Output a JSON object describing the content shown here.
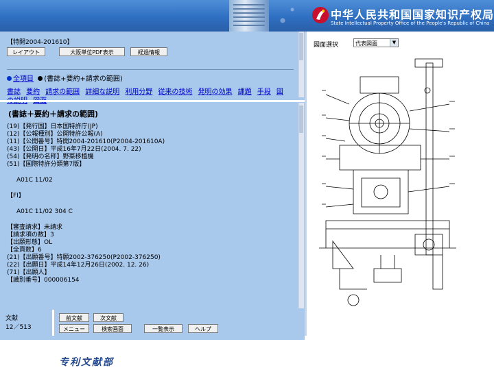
{
  "header": {
    "title_cn": "中华人民共和国国家知识产权局",
    "title_en": "State Intellectual Property Office of the People's Republic of China"
  },
  "document": {
    "id": "【特開2004-201610】",
    "buttons": [
      "レイアウト",
      "大阪単位PDF表示",
      "経過情報"
    ],
    "view_options": [
      "全項目",
      "(書誌+要約+請求の範囲)"
    ],
    "section_links_row1": [
      "書誌",
      "要約",
      "請求の範囲",
      "詳細な説明",
      "利用分野",
      "従来の技術",
      "発明の効果",
      "課題",
      "手段",
      "図"
    ],
    "section_links_row2": [
      "の説明",
      "図面"
    ]
  },
  "content": {
    "section_title": "(書誌＋要約＋請求の範囲)",
    "bibliography": [
      "(19)【発行国】日本国特許庁(JP)",
      "(12)【公報種別】公開特許公報(A)",
      "(11)【公開番号】特開2004-201610(P2004-201610A)",
      "(43)【公開日】平成16年7月22日(2004. 7. 22)",
      "(54)【発明の名称】野菜移植機",
      "(51)【国際特許分類第7版】"
    ],
    "ipc_main": "A01C  11/02",
    "fi_header": "【FI】",
    "fi_value": "A01C   11/02    304 C",
    "filing_info": [
      "【審査請求】未請求",
      "【請求項の数】3",
      "【出願形態】OL",
      "【全頁数】6",
      "(21)【出願番号】特願2002-376250(P2002-376250)",
      "(22)【出願日】平成14年12月26日(2002. 12. 26)",
      "(71)【出願人】",
      "【識別番号】000006154"
    ]
  },
  "figure": {
    "label": "図面選択",
    "selected": "代表図面",
    "arrow": "▼"
  },
  "navigation": {
    "count_label": "文献",
    "count_value": "12／513",
    "buttons_row1": [
      "前文献",
      "次文献"
    ],
    "buttons_row2": [
      "メニュー",
      "検索画面",
      "一覧表示",
      "ヘルプ"
    ]
  },
  "footer": {
    "dept": "专利文献部"
  }
}
